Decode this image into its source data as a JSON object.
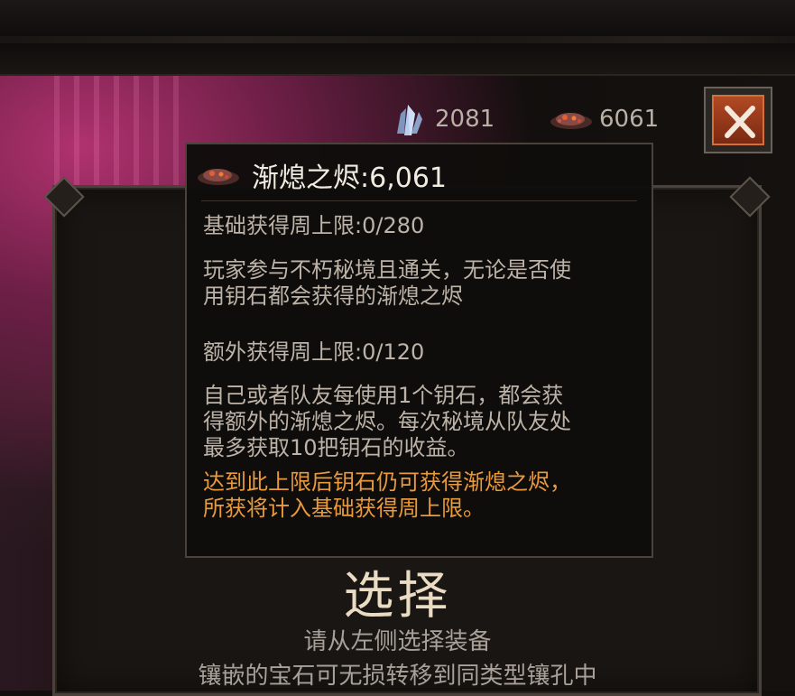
{
  "currencies": {
    "crystal": {
      "icon": "crystal-shard-icon",
      "value": "2081",
      "color": "#9fb4d8"
    },
    "ember": {
      "icon": "smoldering-ember-icon",
      "value": "6061",
      "color": "#c0503a"
    }
  },
  "close_button": {
    "icon": "close-x-icon",
    "accent": "#b24a24"
  },
  "tooltip": {
    "title": "渐熄之烬:6,061",
    "base_limit": "基础获得周上限:0/280",
    "base_desc": "玩家参与不朽秘境且通关，无论是否使\n用钥石都会获得的渐熄之烬",
    "extra_limit": "额外获得周上限:0/120",
    "extra_desc": "自己或者队友每使用1个钥石，都会获\n得额外的渐熄之烬。每次秘境从队友处\n最多获取10把钥石的收益。",
    "warning": "达到此上限后钥石仍可获得渐熄之烬，\n所获将计入基础获得周上限。",
    "warning_color": "#e89a3c"
  },
  "main": {
    "title": "选择",
    "subtitle_1": "请从左侧选择装备",
    "subtitle_2": "镶嵌的宝石可无损转移到同类型镶孔中"
  }
}
